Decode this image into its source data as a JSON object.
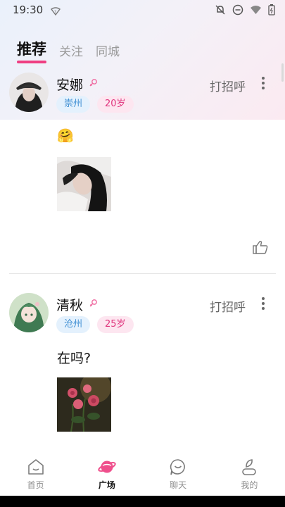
{
  "status_bar": {
    "time": "19:30"
  },
  "tabs": [
    {
      "label": "推荐",
      "active": true
    },
    {
      "label": "关注",
      "active": false
    },
    {
      "label": "同城",
      "active": false
    }
  ],
  "posts": [
    {
      "name": "安娜",
      "gender_icon": "female-icon",
      "city": "崇州",
      "age": "20岁",
      "greet_label": "打招呼",
      "text": "🤗",
      "photo": "woman-lying-photo"
    },
    {
      "name": "清秋",
      "gender_icon": "female-icon",
      "city": "沧州",
      "age": "25岁",
      "greet_label": "打招呼",
      "text": "在吗?",
      "photo": "roses-photo"
    }
  ],
  "nav": [
    {
      "label": "首页",
      "icon": "home-icon",
      "active": false
    },
    {
      "label": "广场",
      "icon": "planet-icon",
      "active": true
    },
    {
      "label": "聊天",
      "icon": "chat-icon",
      "active": false
    },
    {
      "label": "我的",
      "icon": "profile-icon",
      "active": false
    }
  ],
  "colors": {
    "accent": "#ef3e82",
    "city_tag": "#3f8fd3",
    "age_tag": "#e0337c"
  }
}
